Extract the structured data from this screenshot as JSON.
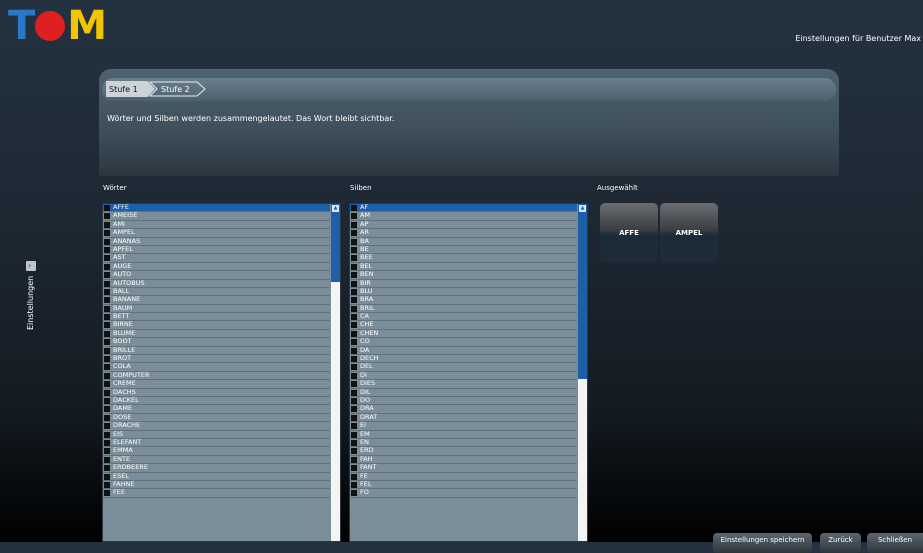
{
  "app": {
    "logo_text": "TOM",
    "user_settings_label": "Einstellungen für Benutzer Max"
  },
  "sidebar": {
    "label": "Einstellungen",
    "toggle_glyph": "›"
  },
  "breadcrumb": {
    "steps": [
      "Stufe 1",
      "Stufe 2"
    ]
  },
  "instruction": "Wörter und Silben werden zusammengelautet. Das Wort bleibt sichtbar.",
  "words": {
    "title": "Wörter",
    "items": [
      "AFFE",
      "AMEISE",
      "AMI",
      "AMPEL",
      "ANANAS",
      "APFEL",
      "AST",
      "AUGE",
      "AUTO",
      "AUTOBUS",
      "BALL",
      "BANANE",
      "BAUM",
      "BETT",
      "BIRNE",
      "BLUME",
      "BOOT",
      "BRILLE",
      "BROT",
      "COLA",
      "COMPUTER",
      "CREME",
      "DACHS",
      "DACKEL",
      "DAME",
      "DOSE",
      "DRACHE",
      "EIS",
      "ELEFANT",
      "EMMA",
      "ENTE",
      "ERDBEERE",
      "ESEL",
      "FAHNE",
      "FEE"
    ],
    "selected_index": 0,
    "scroll_fraction": 0.23
  },
  "syllables": {
    "title": "Silben",
    "items": [
      "AF",
      "AM",
      "AP",
      "AR",
      "BA",
      "BE",
      "BEE",
      "BEL",
      "BEN",
      "BIR",
      "BLU",
      "BRA",
      "BRIL",
      "CA",
      "CHE",
      "CHEN",
      "CO",
      "DA",
      "DECH",
      "DEL",
      "DI",
      "DIES",
      "DIL",
      "DO",
      "DRA",
      "DRAT",
      "EI",
      "EM",
      "EN",
      "ERD",
      "FAH",
      "FANT",
      "FE",
      "FEL",
      "FO"
    ],
    "selected_index": 0,
    "scroll_fraction": 0.52
  },
  "selected": {
    "title": "Ausgewählt",
    "items": [
      "AFFE",
      "AMPEL"
    ]
  },
  "footer_buttons": [
    "Einstellungen speichern",
    "Zurück",
    "Schließen"
  ],
  "colors": {
    "selection": "#1d5fa8",
    "logo_t": "#2a79c9",
    "logo_o": "#e02020",
    "logo_m": "#f2c500"
  }
}
